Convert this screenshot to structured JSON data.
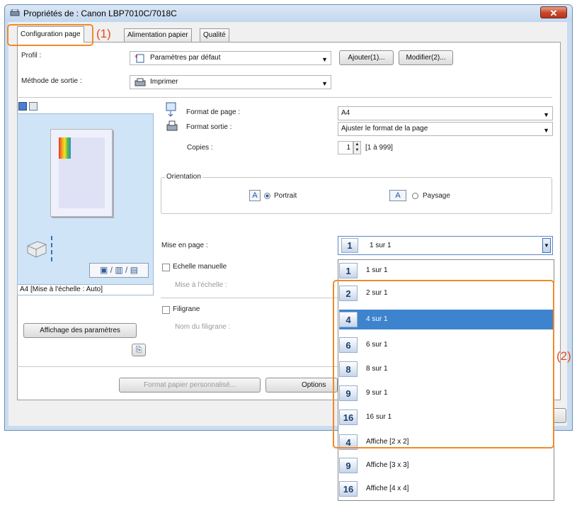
{
  "window": {
    "title": "Propriétés de : Canon LBP7010C/7018C",
    "close_icon": "close-x-icon"
  },
  "tabs": [
    {
      "label": "Configuration page",
      "active": true
    },
    {
      "label": "Alimentation papier",
      "active": false
    },
    {
      "label": "Qualité",
      "active": false
    }
  ],
  "profile": {
    "label": "Profil :",
    "value": "Paramètres par défaut",
    "add_button": "Ajouter(1)...",
    "edit_button": "Modifier(2)..."
  },
  "output_method": {
    "label": "Méthode de sortie :",
    "value": "Imprimer"
  },
  "preview": {
    "status": "A4 [Mise à l'échelle : Auto]",
    "settings_button": "Affichage des paramètres"
  },
  "page_size": {
    "label": "Format de page :",
    "value": "A4"
  },
  "output_size": {
    "label": "Format sortie :",
    "value": "Ajuster le format de la page"
  },
  "copies": {
    "label": "Copies :",
    "value": "1",
    "range": "[1 à 999]"
  },
  "orientation": {
    "legend": "Orientation",
    "portrait": "Portrait",
    "landscape": "Paysage",
    "selected": "portrait"
  },
  "layout": {
    "label": "Mise en page :",
    "selected_num": "1",
    "selected_text": "1 sur 1",
    "options": [
      {
        "num": "1",
        "text": "1 sur 1",
        "selected": false
      },
      {
        "num": "2",
        "text": "2 sur 1",
        "selected": false
      },
      {
        "num": "4",
        "text": "4 sur 1",
        "selected": true
      },
      {
        "num": "6",
        "text": "6 sur 1",
        "selected": false
      },
      {
        "num": "8",
        "text": "8 sur 1",
        "selected": false
      },
      {
        "num": "9",
        "text": "9 sur 1",
        "selected": false
      },
      {
        "num": "16",
        "text": "16 sur 1",
        "selected": false
      },
      {
        "num": "4",
        "text": "Affiche [2 x 2]",
        "selected": false
      },
      {
        "num": "9",
        "text": "Affiche [3 x 3]",
        "selected": false
      },
      {
        "num": "16",
        "text": "Affiche [4 x 4]",
        "selected": false
      }
    ]
  },
  "manual_scale": {
    "label": "Echelle manuelle",
    "sub_label": "Mise à l'échelle :"
  },
  "watermark": {
    "label": "Filigrane",
    "sub_label": "Nom du filigrane :"
  },
  "bottom": {
    "custom_paper_button": "Format papier personnalisé...",
    "options_button": "Options"
  },
  "annotations": {
    "callout_1": "(1)",
    "callout_2": "(2)"
  },
  "colors": {
    "accent": "#f08a28",
    "selection": "#3d83ce",
    "preview_bg": "#cfe5f7"
  }
}
